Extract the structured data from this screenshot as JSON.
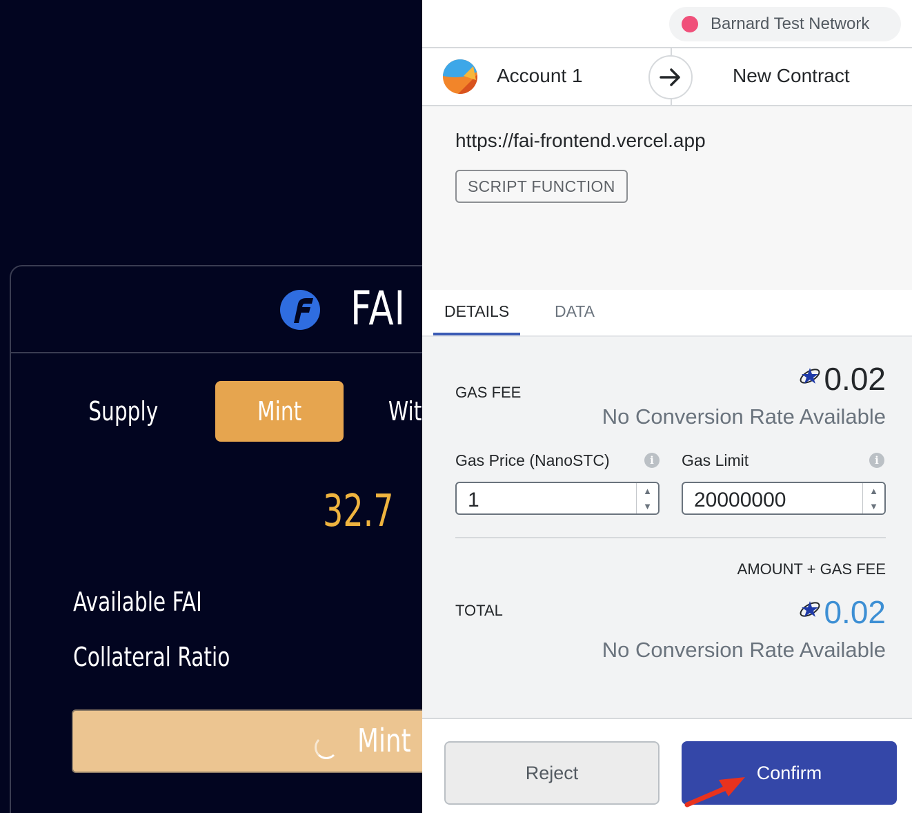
{
  "dapp": {
    "brand": "FAI",
    "tabs": [
      "Supply",
      "Mint",
      "Wit"
    ],
    "active_tab": "Mint",
    "amount": "32.7",
    "info_labels": [
      "Available FAI",
      "Collateral Ratio"
    ],
    "submit_label": "Mint",
    "colors": {
      "background": "#020520",
      "accent": "#e6a54f",
      "amount": "#efb43f"
    }
  },
  "wallet": {
    "network": {
      "name": "Barnard Test Network",
      "dot_color": "#f0507a"
    },
    "from_account": "Account 1",
    "to": "New Contract",
    "origin": "https://fai-frontend.vercel.app",
    "method": "SCRIPT FUNCTION",
    "tabs": {
      "details": "DETAILS",
      "data": "DATA"
    },
    "active_tab": "DETAILS",
    "gas_fee": {
      "label": "GAS FEE",
      "value": "0.02",
      "conversion": "No Conversion Rate Available"
    },
    "gas_price": {
      "label": "Gas Price (NanoSTC)",
      "value": "1"
    },
    "gas_limit": {
      "label": "Gas Limit",
      "value": "20000000"
    },
    "total": {
      "caption": "AMOUNT + GAS FEE",
      "label": "TOTAL",
      "value": "0.02",
      "conversion": "No Conversion Rate Available"
    },
    "buttons": {
      "reject": "Reject",
      "confirm": "Confirm"
    },
    "colors": {
      "confirm": "#3447a8",
      "total_value": "#3d8fd4",
      "tab_underline": "#3b5bb5"
    }
  }
}
